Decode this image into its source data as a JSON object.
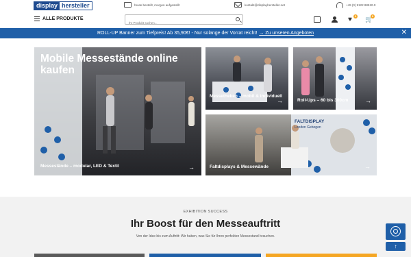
{
  "topbar": {
    "logo_left": "display",
    "logo_right": "hersteller",
    "usps": [
      {
        "icon": "truck-icon",
        "text": "heute bestellt, morgen aufgestellt"
      },
      {
        "icon": "mail-icon",
        "text": "kontakt@displayhersteller.net"
      },
      {
        "icon": "headset-icon",
        "text": "+49 (0) 9122 88510-0"
      }
    ]
  },
  "header": {
    "menu_label": "ALLE PRODUKTE",
    "search_placeholder": "Ihr Produkt suchen...",
    "wishlist_count": "0",
    "cart_count": "0"
  },
  "banner": {
    "text": "ROLL-UP Banner zum Tiefpreis! Ab 35,90€! - Nur solange der Vorrat reicht!",
    "link": "→ Zu unseren Angeboten",
    "close": "✕"
  },
  "tiles": [
    {
      "title": "Mobile Messestände online kaufen",
      "caption": "Messestände – modular, LED & Textil",
      "arrow": "→"
    },
    {
      "caption": "Messetheken – mobil & individuell",
      "arrow": "→"
    },
    {
      "caption": "Roll-Ups – 60 bis 300cm",
      "arrow": "→"
    },
    {
      "caption": "Faltdisplays & Messewände",
      "arrow": "→",
      "image_text_1": "FALTDISPLAY",
      "image_text_2": "London Gebogen"
    }
  ],
  "section": {
    "eyebrow": "EXHIBITION SUCCESS",
    "headline": "Ihr Boost für den Messeauftritt",
    "subline": "Von der Idee bis zum Auftritt: Wir haben, was Sie für Ihren perfekten Messestand brauchen."
  },
  "colors": {
    "brand_blue": "#1f5fa8",
    "logo_blue": "#1f4b8f",
    "badge_orange": "#f5a623",
    "strip_colors": [
      "#5a5a5a",
      "#1f5fa8",
      "#f5a623"
    ]
  }
}
